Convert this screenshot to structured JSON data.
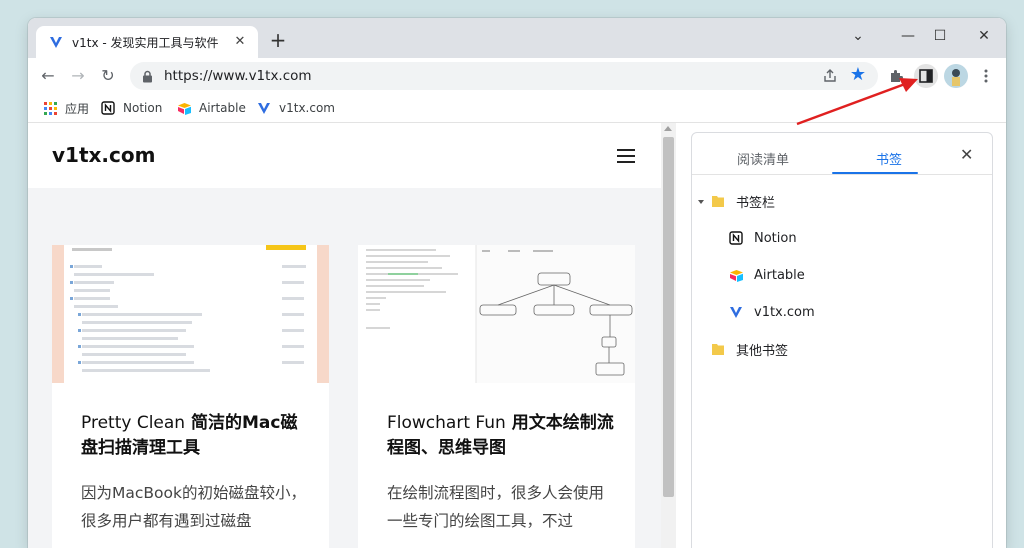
{
  "tab": {
    "title": "v1tx - 发现实用工具与软件",
    "favicon": "v1tx-logo-icon"
  },
  "window_controls": {
    "dropdown": "⌄",
    "minimize": "—",
    "maximize": "☐",
    "close": "✕"
  },
  "address_bar": {
    "url": "https://www.v1tx.com"
  },
  "bookmarks_bar": [
    {
      "label": "应用",
      "icon": "apps-grid-icon"
    },
    {
      "label": "Notion",
      "icon": "notion-icon"
    },
    {
      "label": "Airtable",
      "icon": "airtable-icon"
    },
    {
      "label": "v1tx.com",
      "icon": "v1tx-logo-icon"
    }
  ],
  "site": {
    "name": "v1tx.com",
    "cards": [
      {
        "title_en": "Pretty Clean",
        "title_zh": " 简洁的Mac磁盘扫描清理工具",
        "excerpt": "因为MacBook的初始磁盘较小，很多用户都有遇到过磁盘"
      },
      {
        "title_en": "Flowchart Fun",
        "title_zh": " 用文本绘制流程图、思维导图",
        "excerpt": "在绘制流程图时，很多人会使用一些专门的绘图工具，不过"
      }
    ]
  },
  "side_panel": {
    "tabs": [
      "阅读清单",
      "书签"
    ],
    "active_tab": "书签",
    "folders": {
      "bar": "书签栏",
      "other": "其他书签"
    },
    "items": [
      "Notion",
      "Airtable",
      "v1tx.com"
    ]
  },
  "colors": {
    "accent": "#1a73e8",
    "annotation_arrow": "#e02020"
  }
}
